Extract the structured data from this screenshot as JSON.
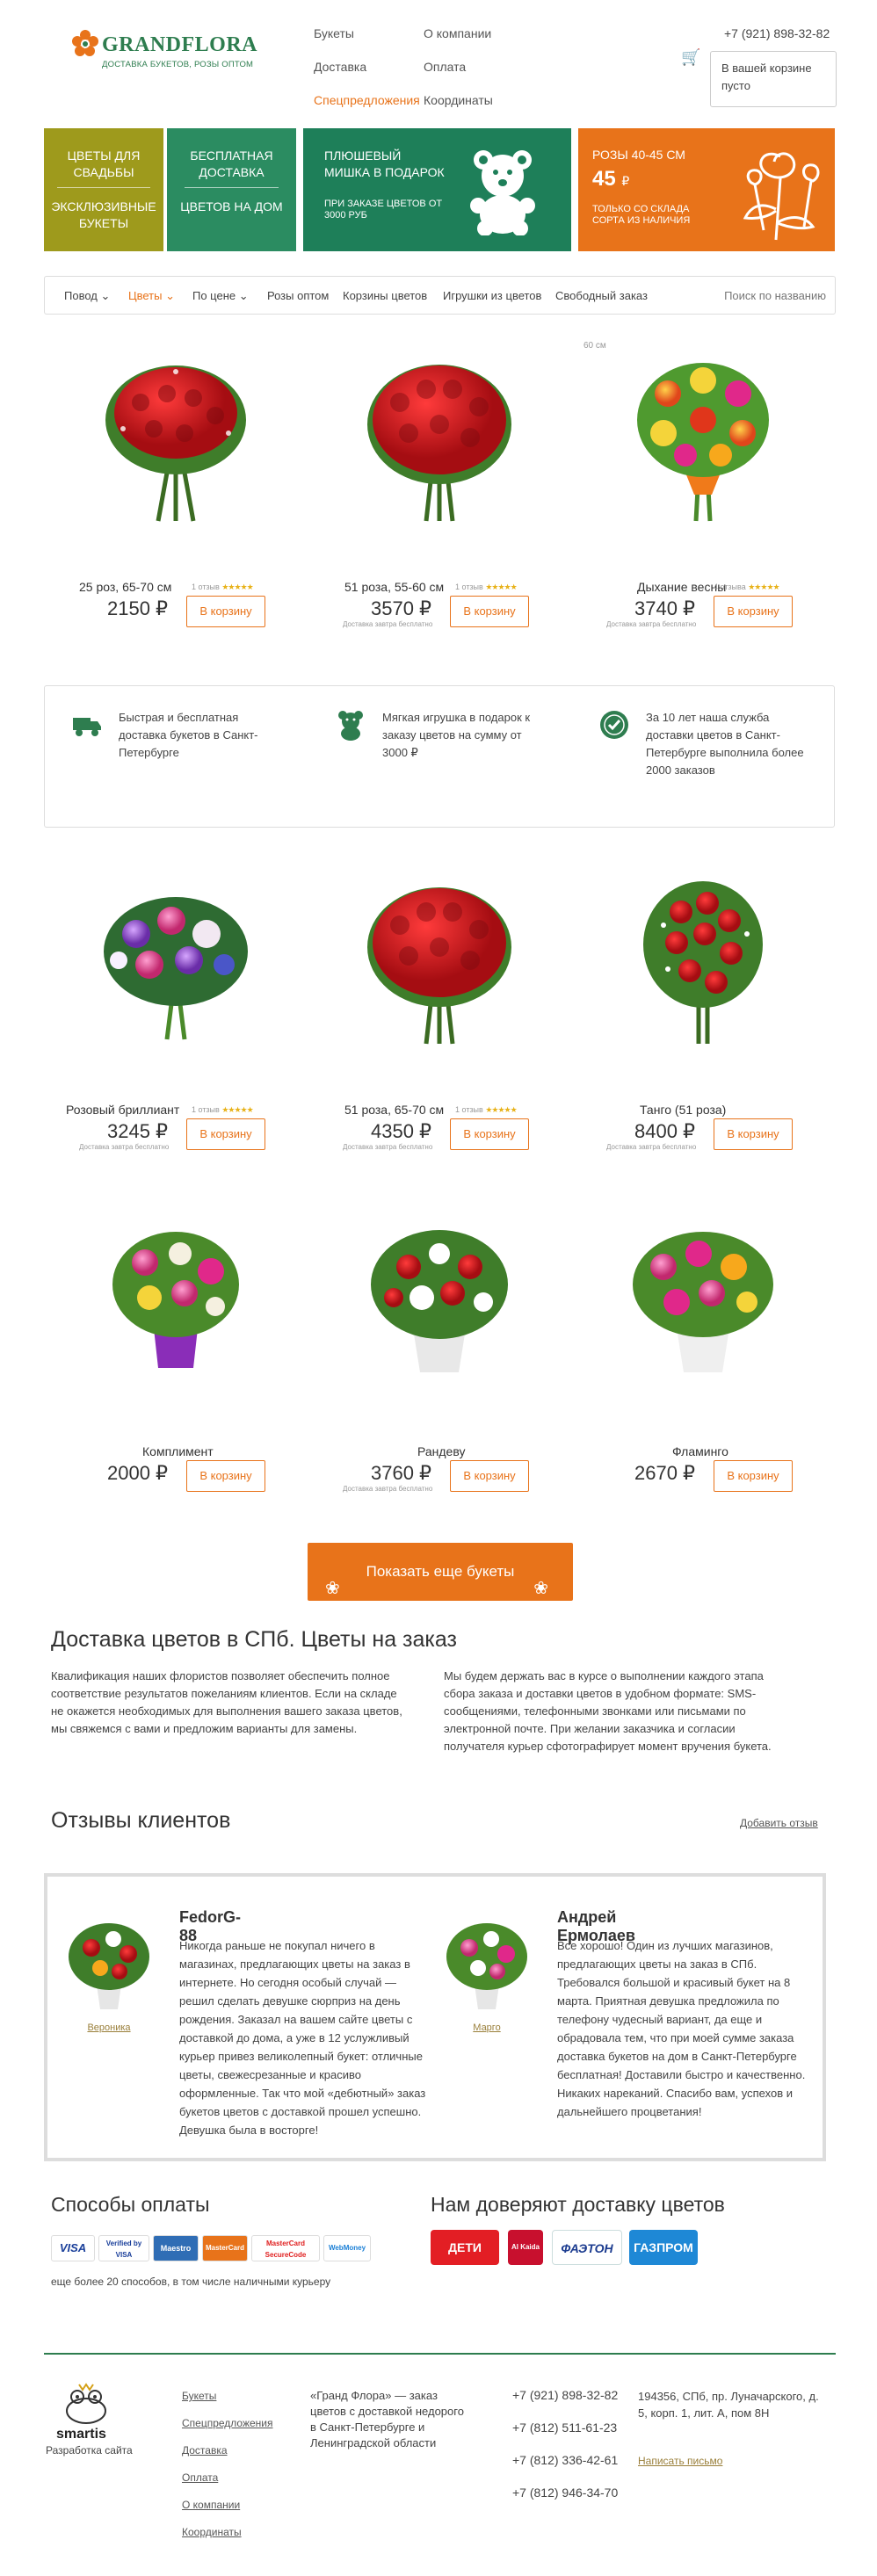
{
  "header": {
    "logo_name": "GRANDFLORA",
    "logo_tagline": "ДОСТАВКА БУКЕТОВ, РОЗЫ ОПТОМ",
    "nav_col1": [
      "Букеты",
      "Доставка",
      "Спецпредложения"
    ],
    "nav_col2": [
      "О компании",
      "Оплата",
      "Координаты"
    ],
    "phone": "+7 (921) 898-32-82",
    "cart_text": "В вашей корзине пусто"
  },
  "banners": {
    "b1_top": "ЦВЕТЫ ДЛЯ СВАДЬБЫ",
    "b1_bottom": "ЭКСКЛЮЗИВНЫЕ БУКЕТЫ",
    "b2_top": "БЕСПЛАТНАЯ ДОСТАВКА",
    "b2_bottom": "ЦВЕТОВ НА ДОМ",
    "b3_top": "ПЛЮШЕВЫЙ МИШКА В ПОДАРОК",
    "b3_bottom": "ПРИ ЗАКАЗЕ ЦВЕТОВ ОТ 3000 РУБ",
    "b4_top": "РОЗЫ 40-45 СМ",
    "b4_price": "45",
    "b4_currency": "₽",
    "b4_bottom": "ТОЛЬКО СО СКЛАДА СОРТА ИЗ НАЛИЧИЯ"
  },
  "menu": {
    "items": [
      "Повод",
      "Цветы",
      "По цене",
      "Розы оптом",
      "Корзины цветов",
      "Игрушки из цветов",
      "Свободный заказ"
    ],
    "search": "Поиск по названию"
  },
  "size_note": "60 см",
  "products": [
    {
      "name": "25 роз, 65-70 см",
      "reviews": "1 отзыв",
      "price": "2150 ₽",
      "delivery": "",
      "button": "В корзину"
    },
    {
      "name": "51 роза, 55-60 см",
      "reviews": "1 отзыв",
      "price": "3570 ₽",
      "delivery": "Доставка завтра бесплатно",
      "button": "В корзину"
    },
    {
      "name": "Дыхание весны",
      "reviews": "4 отзыва",
      "price": "3740 ₽",
      "delivery": "Доставка завтра бесплатно",
      "button": "В корзину"
    },
    {
      "name": "Розовый бриллиант",
      "reviews": "1 отзыв",
      "price": "3245 ₽",
      "delivery": "Доставка завтра бесплатно",
      "button": "В корзину"
    },
    {
      "name": "51 роза, 65-70 см",
      "reviews": "1 отзыв",
      "price": "4350 ₽",
      "delivery": "Доставка завтра бесплатно",
      "button": "В корзину"
    },
    {
      "name": "Танго (51 роза)",
      "reviews": "",
      "price": "8400 ₽",
      "delivery": "Доставка завтра бесплатно",
      "button": "В корзину"
    },
    {
      "name": "Комплимент",
      "reviews": "",
      "price": "2000 ₽",
      "delivery": "",
      "button": "В корзину"
    },
    {
      "name": "Рандеву",
      "reviews": "",
      "price": "3760 ₽",
      "delivery": "Доставка завтра бесплатно",
      "button": "В корзину"
    },
    {
      "name": "Фламинго",
      "reviews": "",
      "price": "2670 ₽",
      "delivery": "",
      "button": "В корзину"
    }
  ],
  "rating_stars": "★★★★★",
  "features": [
    "Быстрая и бесплатная доставка букетов в Санкт-Петербурге",
    "Мягкая игрушка в подарок к заказу цветов на сумму от 3000 ₽",
    "За 10 лет наша служба доставки цветов в Санкт-Петербурге выполнила более 2000 заказов"
  ],
  "show_more": "Показать еще букеты",
  "seo": {
    "title": "Доставка цветов в СПб. Цветы на заказ",
    "left": "Квалификация наших флористов позволяет обеспечить полное соответствие результатов пожеланиям клиентов. Если на складе не окажется необходимых для выполнения вашего заказа цветов, мы свяжемся с вами и предложим варианты для замены.",
    "right": "Мы будем держать вас в курсе о выполнении каждого этапа сбора заказа и доставки цветов в удобном формате: SMS-сообщениями, телефонными звонками или письмами по электронной почте. При желании заказчика и согласии получателя курьер сфотографирует момент вручения букета."
  },
  "reviews": {
    "title": "Отзывы клиентов",
    "add": "Добавить отзыв",
    "items": [
      {
        "author": "FedorG-88",
        "caption": "Вероника",
        "text": "Никогда раньше не покупал ничего в магазинах, предлагающих цветы на заказ в интернете. Но сегодня особый случай — решил сделать девушке сюрприз на день рождения. Заказал на вашем сайте цветы с доставкой до дома, а уже в 12 услужливый курьер привез великолепный букет: отличные цветы, свежесрезанные и красиво оформленные. Так что мой «дебютный» заказ букетов цветов с доставкой прошел успешно. Девушка была в восторге!"
      },
      {
        "author": "Андрей Ермолаев",
        "caption": "Марго",
        "text": "Все хорошо! Один из лучших магазинов, предлагающих цветы на заказ в СПб. Требовался большой и красивый букет на 8 марта. Приятная девушка предложила по телефону чудесный вариант, да еще и обрадовала тем, что при моей сумме заказа доставка букетов на дом в Санкт-Петербурге бесплатная! Доставили быстро и качественно. Никаких нареканий. Спасибо вам, успехов и дальнейшего процветания!"
      }
    ]
  },
  "payment": {
    "title": "Способы оплаты",
    "methods": [
      "VISA",
      "Verified by VISA",
      "Maestro",
      "MasterCard",
      "MasterCard SecureCode",
      "WebMoney"
    ],
    "note": "еще более 20 способов, в том числе наличными курьеру"
  },
  "partners": {
    "title": "Нам доверяют доставку цветов",
    "items": [
      "ДЕТИ",
      "Al Kaida",
      "ФАЭТОН",
      "ГАЗПРОМ"
    ]
  },
  "footer": {
    "dev_name": "smartis",
    "dev_label": "Разработка сайта",
    "links": [
      "Букеты",
      "Спецпредложения",
      "Доставка",
      "Оплата",
      "О компании",
      "Координаты"
    ],
    "about": "«Гранд Флора» — заказ цветов с доставкой недорого в Санкт-Петербурге и Ленинградской области",
    "phones": [
      "+7 (921) 898-32-82",
      "+7 (812) 511-61-23",
      "+7 (812) 336-42-61",
      "+7 (812) 946-34-70"
    ],
    "address": "194356, СПб, пр. Луначарского, д. 5, корп. 1, лит. А, пом 8Н",
    "mail": "Написать письмо"
  },
  "colors": {
    "brand_green": "#2e7d4f",
    "accent_orange": "#e8731a",
    "olive": "#9e9a1c"
  }
}
